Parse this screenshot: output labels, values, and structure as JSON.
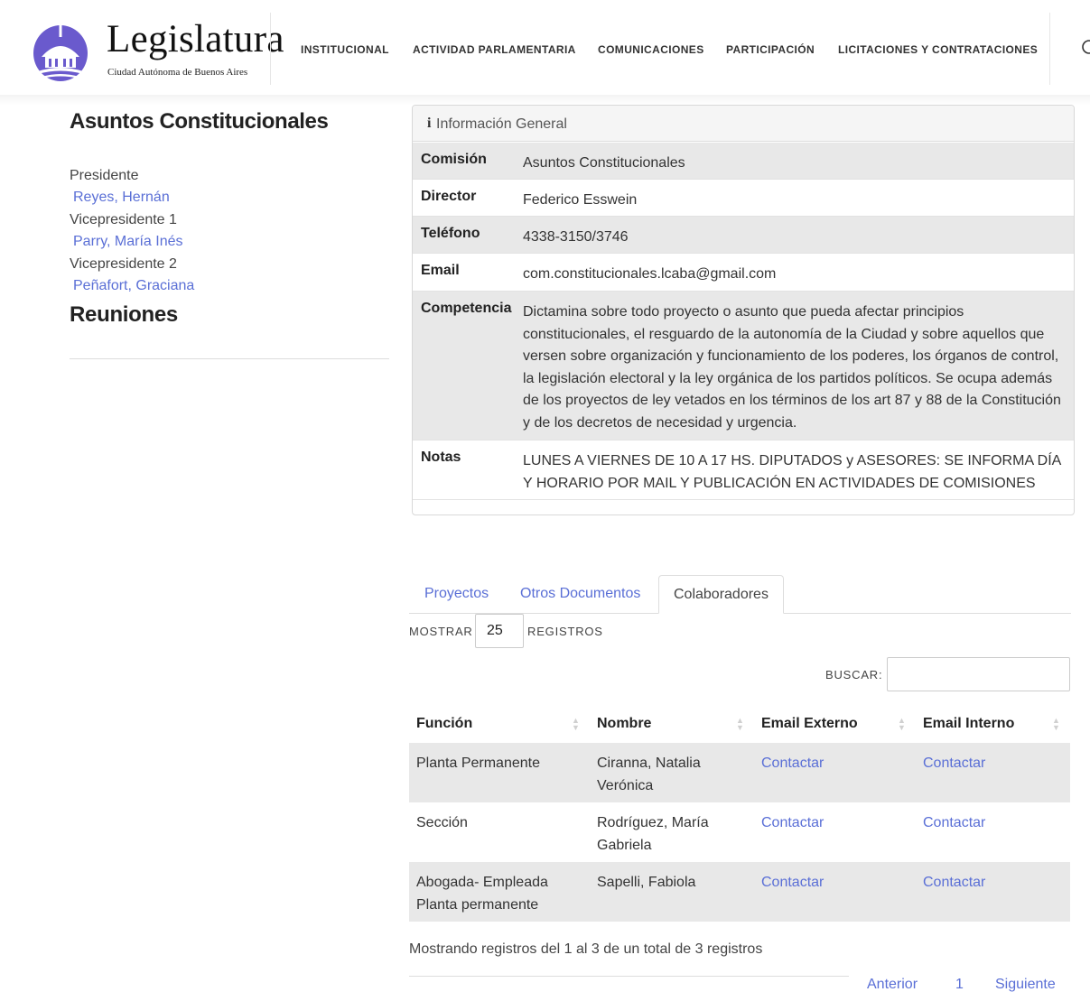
{
  "header": {
    "logo_title": "Legislatura",
    "logo_subtitle": "Ciudad Autónoma de Buenos Aires",
    "nav": [
      "INSTITUCIONAL",
      "ACTIVIDAD PARLAMENTARIA",
      "COMUNICACIONES",
      "PARTICIPACIÓN",
      "LICITACIONES Y CONTRATACIONES"
    ],
    "search_icon": "search-icon",
    "brand_color": "#6a5acd"
  },
  "left": {
    "title": "Asuntos Constitucionales",
    "roles": [
      {
        "role": "Presidente",
        "name": "Reyes, Hernán"
      },
      {
        "role": "Vicepresidente 1",
        "name": "Parry, María Inés"
      },
      {
        "role": "Vicepresidente 2",
        "name": "Peñafort, Graciana"
      }
    ],
    "reuniones": "Reuniones"
  },
  "info": {
    "icon": "info-icon",
    "header": "Información General",
    "rows": [
      {
        "label": "Comisión",
        "value": "Asuntos Constitucionales"
      },
      {
        "label": "Director",
        "value": "Federico Esswein"
      },
      {
        "label": "Teléfono",
        "value": "4338-3150/3746"
      },
      {
        "label": "Email",
        "value": "com.constitucionales.lcaba@gmail.com"
      },
      {
        "label": "Competencia",
        "value": "Dictamina sobre todo proyecto o asunto que pueda afectar principios constitucionales, el resguardo de la autonomía de la Ciudad y sobre aquellos que versen sobre organización y funcionamiento de los poderes, los órganos de control, la legislación electoral y la ley orgánica de los partidos políticos. Se ocupa además de los proyectos de ley vetados en los términos de los art 87 y 88 de la Constitución y de los decretos de necesidad y urgencia."
      },
      {
        "label": "Notas",
        "value": "LUNES A VIERNES DE 10 A 17 HS. DIPUTADOS y ASESORES: SE INFORMA DÍA Y HORARIO POR MAIL Y PUBLICACIÓN EN ACTIVIDADES DE COMISIONES"
      }
    ]
  },
  "tabs": [
    "Proyectos",
    "Otros Documentos",
    "Colaboradores"
  ],
  "table_controls": {
    "show_label": "MOSTRAR",
    "page_length": "25",
    "records_label": "REGISTROS",
    "search_label": "BUSCAR:",
    "search_value": ""
  },
  "table": {
    "columns": [
      "Función",
      "Nombre",
      "Email Externo",
      "Email Interno"
    ],
    "rows": [
      [
        "Planta Permanente",
        "Ciranna, Natalia Verónica",
        "Contactar",
        "Contactar"
      ],
      [
        "Sección",
        "Rodríguez, María Gabriela",
        "Contactar",
        "Contactar"
      ],
      [
        "Abogada- Empleada Planta permanente",
        "Sapelli, Fabiola",
        "Contactar",
        "Contactar"
      ]
    ],
    "info": "Mostrando registros del 1 al 3 de un total de 3 registros",
    "pager": {
      "prev": "Anterior",
      "page": "1",
      "next": "Siguiente"
    }
  }
}
